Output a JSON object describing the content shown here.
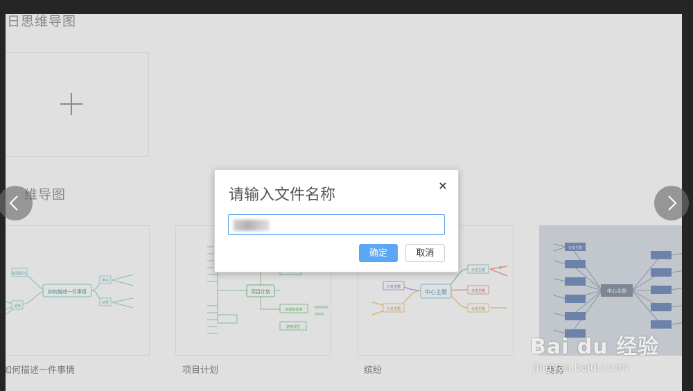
{
  "sections": {
    "my_mindmaps_title": "日思维导图",
    "templates_title": "维导图"
  },
  "templates": [
    {
      "label": "如何描述一件事情"
    },
    {
      "label": "项目计划"
    },
    {
      "label": "缤纷"
    },
    {
      "label": "商务"
    }
  ],
  "mini_maps": {
    "card1": {
      "center": "如何描述一件事情",
      "b1": "起因经过",
      "b2": "结果",
      "r1": "要点",
      "r2": "结果"
    },
    "card2": {
      "center": "项目计划",
      "r1": "计划",
      "r2": "目标和任务",
      "r3": "进度评估"
    },
    "card3": {
      "center": "中心主题",
      "b1": "分支主题",
      "b2": "分支主题",
      "b3": "分支主题",
      "b4": "分支主题",
      "b5": "分支主题"
    },
    "card4": {
      "center": "中心主题",
      "b1": "分支主题"
    }
  },
  "dialog": {
    "title": "请输入文件名称",
    "close_glyph": "×",
    "ok_label": "确定",
    "cancel_label": "取消"
  },
  "nav": {
    "prev_icon": "chevron-left-icon",
    "next_icon": "chevron-right-icon"
  },
  "watermark": {
    "brand": "Bai du 经验",
    "url": "jingyan.baidu.com"
  },
  "colors": {
    "primary_button": "#5ba7f5",
    "input_focus_border": "#5ea3f0",
    "page_background": "#ffffff",
    "frame": "#2b2b2b"
  }
}
